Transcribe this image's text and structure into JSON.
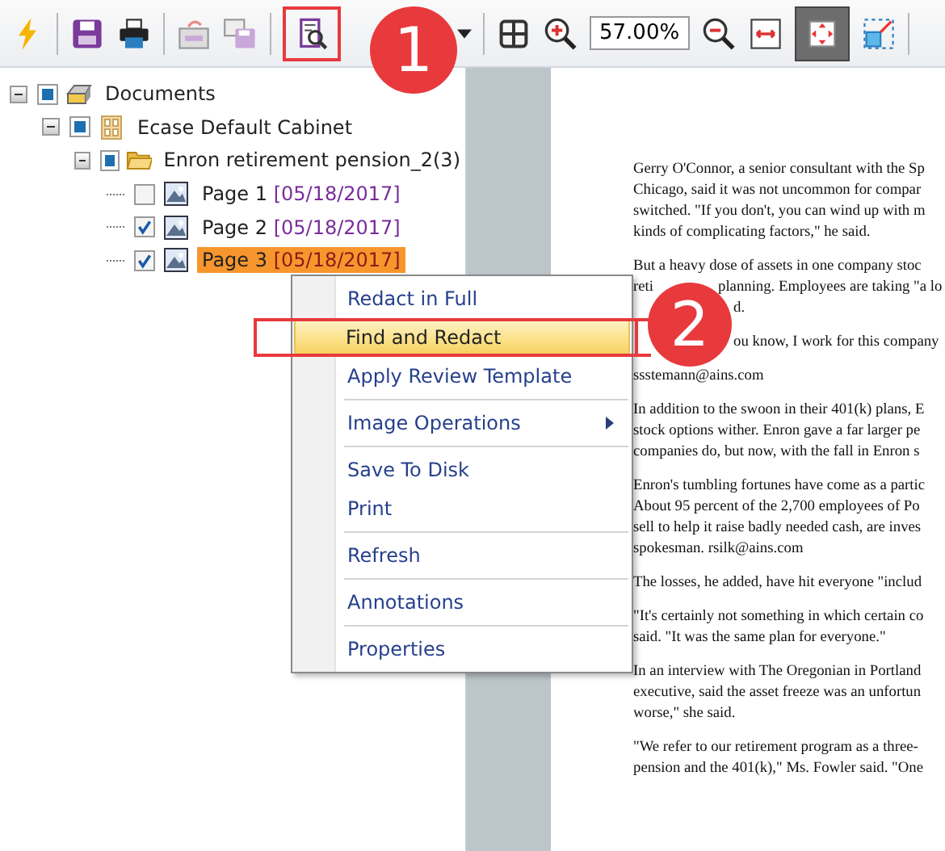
{
  "toolbar": {
    "zoom_value": "57.00%",
    "fit_page_selected": true
  },
  "callouts": [
    "1",
    "2"
  ],
  "tree": [
    {
      "label": "Documents",
      "kind": "root",
      "partial": true,
      "expanded": true,
      "children": [
        {
          "label": "Ecase Default Cabinet",
          "kind": "cabinet",
          "partial": true,
          "expanded": true,
          "children": [
            {
              "label": "Enron retirement pension_2",
              "count": "(3)",
              "kind": "folder",
              "partial": true,
              "expanded": true,
              "children": [
                {
                  "label": "Page 1",
                  "date": "[05/18/2017]",
                  "kind": "page",
                  "checked": false,
                  "selected": false
                },
                {
                  "label": "Page 2",
                  "date": "[05/18/2017]",
                  "kind": "page",
                  "checked": true,
                  "selected": false
                },
                {
                  "label": "Page 3",
                  "date": "[05/18/2017]",
                  "kind": "page",
                  "checked": true,
                  "selected": true
                }
              ]
            }
          ]
        }
      ]
    }
  ],
  "context_menu": [
    {
      "label": "Redact in Full",
      "selected": false,
      "submenu": false,
      "separator_after": false
    },
    {
      "label": "Find and Redact",
      "selected": true,
      "submenu": false,
      "separator_after": false
    },
    {
      "label": "Apply Review Template",
      "selected": false,
      "submenu": false,
      "separator_after": true
    },
    {
      "label": "Image Operations",
      "selected": false,
      "submenu": true,
      "separator_after": true
    },
    {
      "label": "Save To Disk",
      "selected": false,
      "submenu": false,
      "separator_after": false
    },
    {
      "label": "Print",
      "selected": false,
      "submenu": false,
      "separator_after": true
    },
    {
      "label": "Refresh",
      "selected": false,
      "submenu": false,
      "separator_after": true
    },
    {
      "label": "Annotations",
      "selected": false,
      "submenu": false,
      "separator_after": true
    },
    {
      "label": "Properties",
      "selected": false,
      "submenu": false,
      "separator_after": false
    }
  ],
  "document": [
    {
      "lines": [
        {
          "parts": [
            "Gerry O'Connor, a senior consultant with the Sp"
          ]
        },
        {
          "parts": [
            "Chicago, said it was not uncommon for compar"
          ]
        },
        {
          "parts": [
            "switched. \"If you don't, you can wind up with m"
          ]
        },
        {
          "parts": [
            "kinds of complicating factors,\" he said."
          ]
        }
      ]
    },
    {
      "lines": [
        {
          "parts": [
            "But a heavy dose of assets in one company stoc"
          ]
        },
        {
          "parts": [
            "reti",
            "planning. Employees are taking \"a lo"
          ]
        },
        {
          "parts": [
            "d."
          ],
          "hidden_start": true
        }
      ]
    },
    {
      "lines": [
        {
          "parts": [
            "ou know, I work for this company"
          ],
          "hidden_start": true
        }
      ]
    },
    {
      "lines": [
        {
          "parts": [
            "ssstemann@ains.com"
          ]
        }
      ]
    },
    {
      "lines": [
        {
          "parts": [
            "In addition to the swoon in their 401(k) plans, E"
          ]
        },
        {
          "parts": [
            "stock options wither. Enron gave a far larger pe"
          ]
        },
        {
          "parts": [
            "companies do, but now, with the fall in Enron s"
          ]
        }
      ]
    },
    {
      "lines": [
        {
          "parts": [
            "Enron's tumbling fortunes have come as a partic"
          ]
        },
        {
          "parts": [
            "About 95 percent of the 2,700 employees of Po"
          ]
        },
        {
          "parts": [
            "sell to help it raise badly needed cash, are inves"
          ]
        },
        {
          "parts": [
            "spokesman. rsilk@ains.com"
          ]
        }
      ]
    },
    {
      "lines": [
        {
          "parts": [
            "The losses, he added, have hit everyone \"includ"
          ]
        }
      ]
    },
    {
      "lines": [
        {
          "parts": [
            "\"It's certainly not something in which certain co"
          ]
        },
        {
          "parts": [
            "said. \"It was the same plan for everyone.\""
          ]
        }
      ]
    },
    {
      "lines": [
        {
          "parts": [
            "In an interview with The Oregonian in Portland"
          ]
        },
        {
          "parts": [
            "executive, said the asset freeze was an unfortun"
          ]
        },
        {
          "parts": [
            "worse,\" she said."
          ]
        }
      ]
    },
    {
      "lines": [
        {
          "parts": [
            "\"We refer to our retirement program as a three-"
          ]
        },
        {
          "parts": [
            "pension and the 401(k),\" Ms. Fowler said. \"One"
          ]
        }
      ]
    }
  ]
}
